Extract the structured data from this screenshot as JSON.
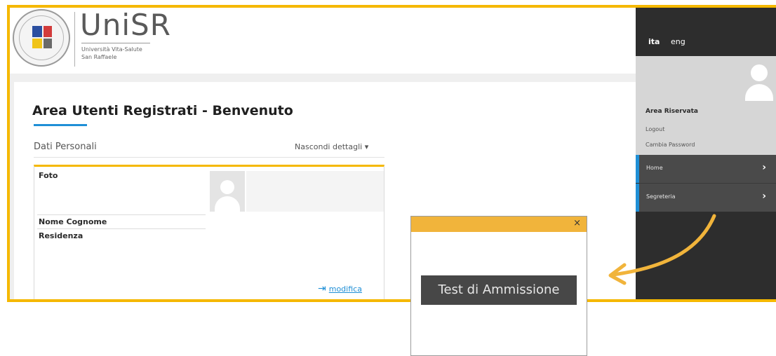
{
  "header": {
    "logo_name": "UniSR",
    "logo_subtitle_1": "Università Vita-Salute",
    "logo_subtitle_2": "San Raffaele"
  },
  "main": {
    "title": "Area Utenti Registrati - Benvenuto",
    "section_label": "Dati Personali",
    "details_toggle": "Nascondi dettagli ▾",
    "fields": {
      "foto": "Foto",
      "nome_cognome": "Nome Cognome",
      "residenza": "Residenza"
    },
    "edit_link": "modifica"
  },
  "sidebar": {
    "lang_ita": "ita",
    "lang_eng": "eng",
    "area_title": "Area Riservata",
    "logout": "Logout",
    "change_password": "Cambia Password",
    "nav": [
      {
        "label": "Home",
        "chevron": "›"
      },
      {
        "label": "Segreteria",
        "chevron": "›"
      }
    ]
  },
  "dialog": {
    "close": "×",
    "button_label": "Test di Ammissione"
  },
  "colors": {
    "frame_yellow": "#f5b800",
    "dialog_header": "#f1b43b",
    "accent_blue": "#1f8fd6",
    "sidebar_dark": "#2d2d2d"
  }
}
